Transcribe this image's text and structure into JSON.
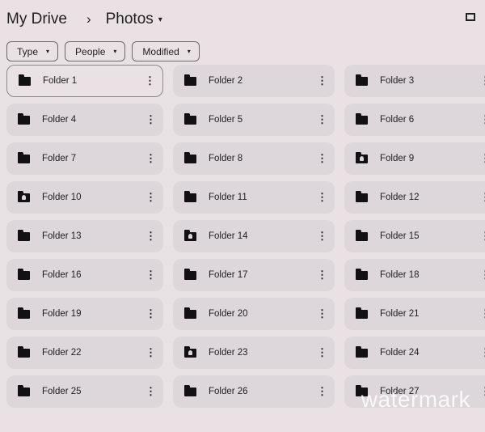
{
  "breadcrumb": {
    "root": "My Drive",
    "separator": "›",
    "current": "Photos",
    "caret": "▾"
  },
  "filters": [
    {
      "label": "Type",
      "caret": "▾"
    },
    {
      "label": "People",
      "caret": "▾"
    },
    {
      "label": "Modified",
      "caret": "▾"
    }
  ],
  "folders": [
    {
      "name": "Folder 1",
      "shared": false,
      "selected": true
    },
    {
      "name": "Folder 2",
      "shared": false
    },
    {
      "name": "Folder 3",
      "shared": false
    },
    {
      "name": "Folder 4",
      "shared": false
    },
    {
      "name": "Folder 5",
      "shared": false
    },
    {
      "name": "Folder 6",
      "shared": false
    },
    {
      "name": "Folder 7",
      "shared": false
    },
    {
      "name": "Folder 8",
      "shared": false
    },
    {
      "name": "Folder 9",
      "shared": true
    },
    {
      "name": "Folder 10",
      "shared": true
    },
    {
      "name": "Folder 11",
      "shared": false
    },
    {
      "name": "Folder 12",
      "shared": false
    },
    {
      "name": "Folder 13",
      "shared": false
    },
    {
      "name": "Folder 14",
      "shared": true
    },
    {
      "name": "Folder 15",
      "shared": false
    },
    {
      "name": "Folder 16",
      "shared": false
    },
    {
      "name": "Folder 17",
      "shared": false
    },
    {
      "name": "Folder 18",
      "shared": false
    },
    {
      "name": "Folder 19",
      "shared": false
    },
    {
      "name": "Folder 20",
      "shared": false
    },
    {
      "name": "Folder 21",
      "shared": false
    },
    {
      "name": "Folder 22",
      "shared": false
    },
    {
      "name": "Folder 23",
      "shared": true
    },
    {
      "name": "Folder 24",
      "shared": false
    },
    {
      "name": "Folder 25",
      "shared": false
    },
    {
      "name": "Folder 26",
      "shared": false
    },
    {
      "name": "Folder 27",
      "shared": false
    }
  ],
  "more_glyph": "⋮",
  "watermark": "watermark"
}
